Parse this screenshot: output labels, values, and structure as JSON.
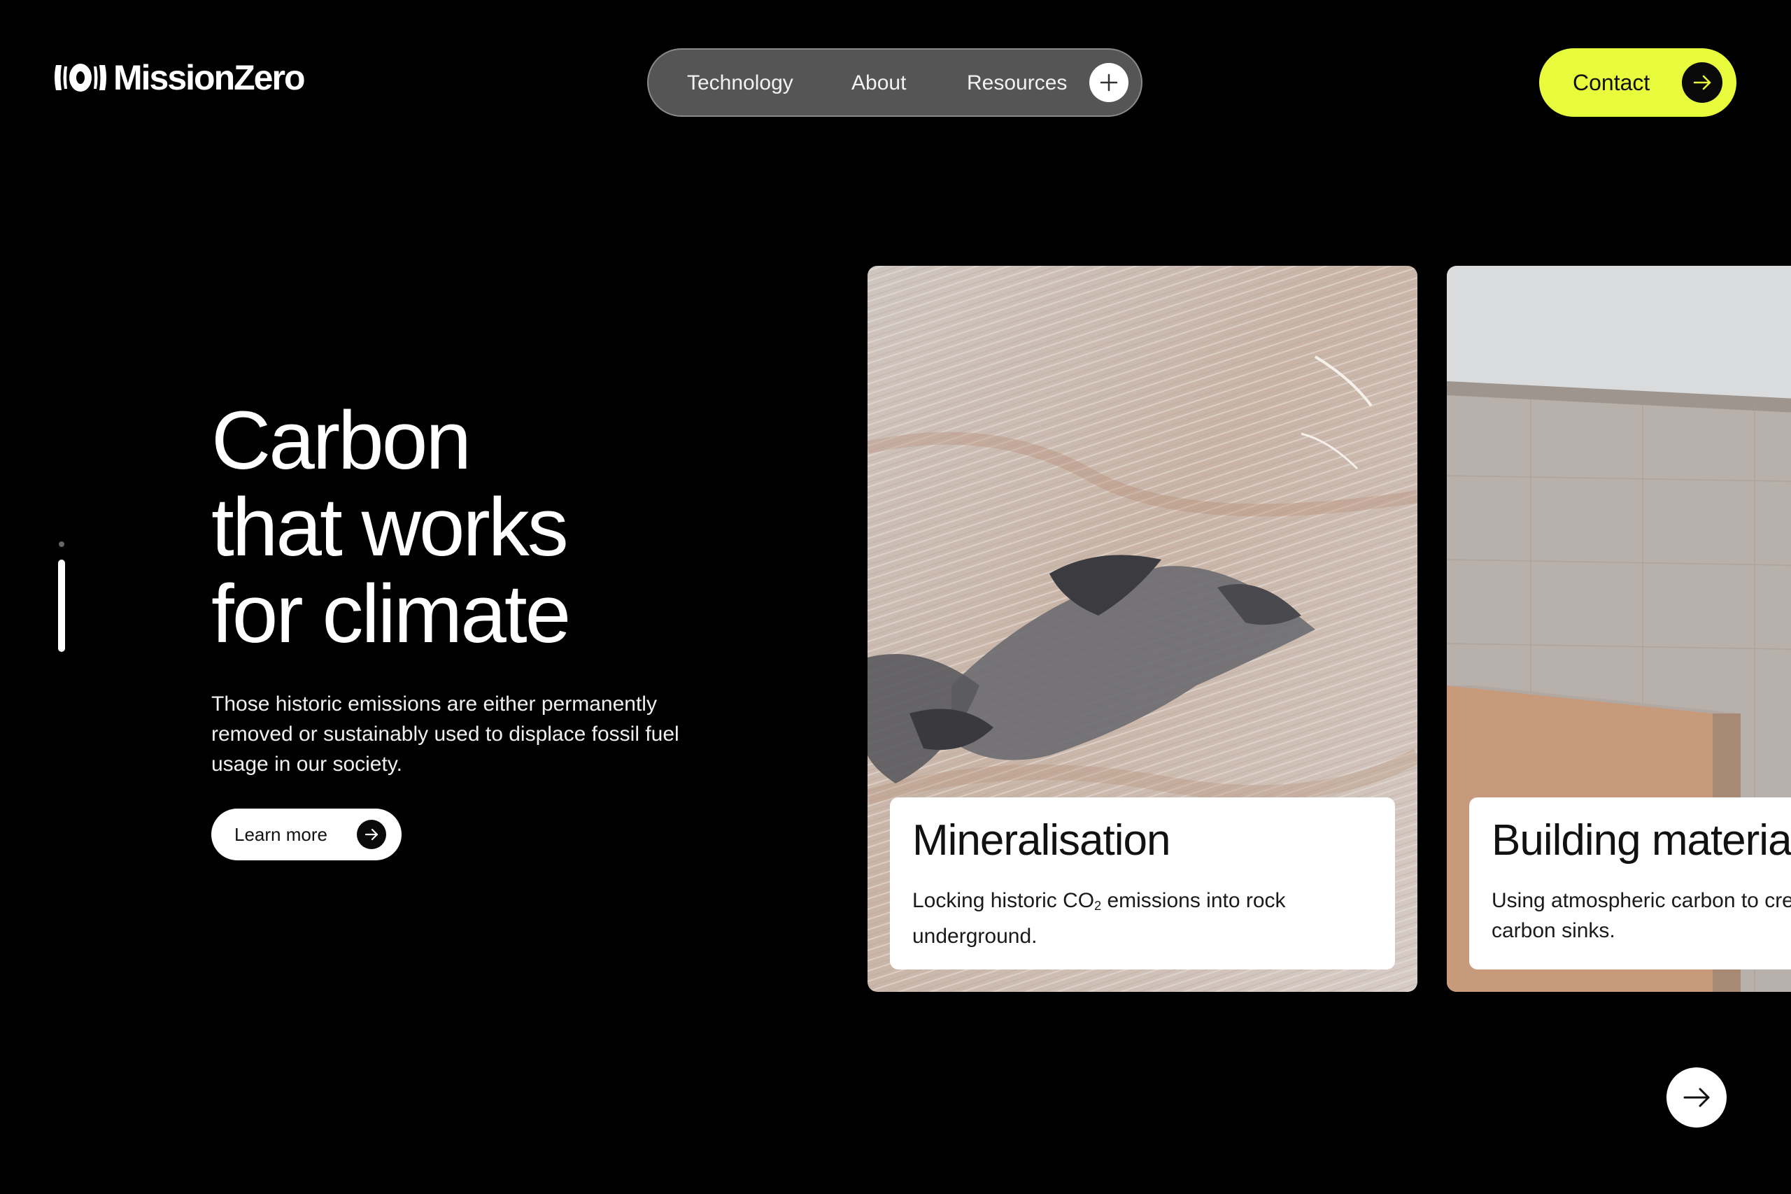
{
  "brand": {
    "name": "MissionZero",
    "logo_icon": "missionzero-mark-icon"
  },
  "nav": {
    "items": [
      {
        "label": "Technology"
      },
      {
        "label": "About"
      },
      {
        "label": "Resources"
      }
    ],
    "expand_icon": "plus-icon"
  },
  "contact": {
    "label": "Contact",
    "icon": "arrow-right-icon",
    "bg_color": "#e8fb3c"
  },
  "hero": {
    "title_lines": [
      "Carbon",
      "that works",
      "for climate"
    ],
    "description": "Those historic emissions are either permanently removed or sustainably used to displace fossil fuel usage in our society.",
    "cta_label": "Learn more",
    "cta_icon": "arrow-right-icon",
    "slide_indicator": {
      "active": 2,
      "total": 2
    }
  },
  "cards": [
    {
      "title": "Mineralisation",
      "desc_before_sub": "Locking historic CO",
      "desc_sub": "2",
      "desc_after_sub": " emissions into rock",
      "desc_line2": "underground.",
      "image": "rock-surface-image"
    },
    {
      "title": "Building materials",
      "desc_line1": "Using atmospheric carbon to create",
      "desc_line2": "carbon sinks.",
      "image": "concrete-building-image"
    }
  ],
  "carousel": {
    "next_icon": "arrow-right-icon"
  },
  "colors": {
    "background": "#000000",
    "accent": "#e8fb3c",
    "nav_pill": "#555555"
  }
}
